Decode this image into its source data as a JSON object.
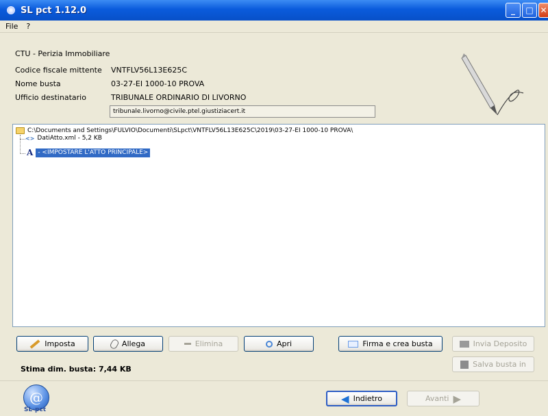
{
  "window": {
    "title": "SL pct 1.12.0"
  },
  "menu": {
    "items": [
      "File",
      "?"
    ]
  },
  "info": {
    "heading": "CTU - Perizia Immobiliare",
    "fields": [
      {
        "label": "Codice fiscale mittente",
        "value": "VNTFLV56L13E625C"
      },
      {
        "label": "Nome busta",
        "value": "03-27-EI 1000-10 PROVA"
      },
      {
        "label": "Ufficio destinatario",
        "value": "TRIBUNALE ORDINARIO DI LIVORNO"
      }
    ],
    "email": "tribunale.livorno@civile.ptel.giustiziacert.it"
  },
  "tree": {
    "root_path": "C:\\Documents and Settings\\FULVIO\\Documenti\\SLpct\\VNTFLV56L13E625C\\2019\\03-27-EI 1000-10 PROVA\\",
    "file1": "DatiAtto.xml - 5,2 KB",
    "file2": " - <IMPOSTARE L'ATTO PRINCIPALE>"
  },
  "buttons": {
    "imposta": "Imposta",
    "allega": "Allega",
    "elimina": "Elimina",
    "apri": "Apri",
    "firma": "Firma e crea busta",
    "invia": "Invia Deposito",
    "salva": "Salva busta in",
    "indietro": "Indietro",
    "avanti": "Avanti"
  },
  "estimate": "Stima dim. busta: 7,44 KB",
  "logo": {
    "symbol": "@",
    "text": "SL-pct"
  }
}
